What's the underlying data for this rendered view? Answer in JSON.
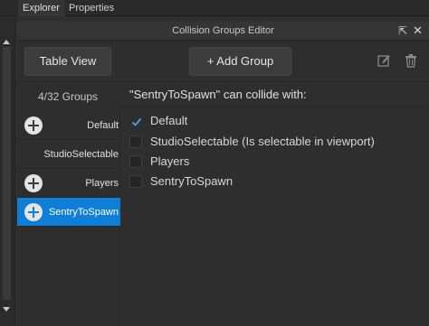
{
  "top_tabs": [
    "Explorer",
    "Properties"
  ],
  "window": {
    "title": "Collision Groups Editor",
    "popout_glyph": "⇱",
    "close_glyph": "✕"
  },
  "toolbar": {
    "table_view_label": "Table View",
    "add_group_label": "+ Add Group",
    "icons": [
      "edit-icon",
      "trash-icon"
    ]
  },
  "groups": {
    "count_label": "4/32 Groups",
    "items": [
      {
        "label": "Default",
        "has_plus_icon": true,
        "selected": false
      },
      {
        "label": "StudioSelectable",
        "has_plus_icon": false,
        "selected": false
      },
      {
        "label": "Players",
        "has_plus_icon": true,
        "selected": false
      },
      {
        "label": "SentryToSpawn",
        "has_plus_icon": true,
        "selected": true
      }
    ]
  },
  "detail": {
    "title": "\"SentryToSpawn\" can collide with:",
    "options": [
      {
        "label": "Default",
        "checked": true
      },
      {
        "label": "StudioSelectable (Is selectable in viewport)",
        "checked": false
      },
      {
        "label": "Players",
        "checked": false
      },
      {
        "label": "SentryToSpawn",
        "checked": false
      }
    ]
  },
  "colors": {
    "selection": "#0e7ed6",
    "background": "#2e2e2e",
    "button": "#3c3c3c",
    "check": "#4aa3e8"
  }
}
